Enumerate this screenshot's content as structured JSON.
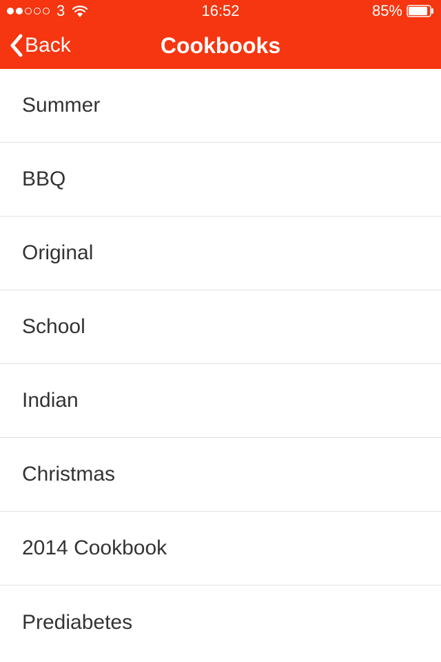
{
  "statusBar": {
    "carrier": "3",
    "time": "16:52",
    "batteryPercent": "85%"
  },
  "navBar": {
    "backLabel": "Back",
    "title": "Cookbooks"
  },
  "list": {
    "items": [
      {
        "label": "Summer"
      },
      {
        "label": "BBQ"
      },
      {
        "label": "Original"
      },
      {
        "label": "School"
      },
      {
        "label": "Indian"
      },
      {
        "label": "Christmas"
      },
      {
        "label": "2014 Cookbook"
      },
      {
        "label": "Prediabetes"
      }
    ]
  }
}
